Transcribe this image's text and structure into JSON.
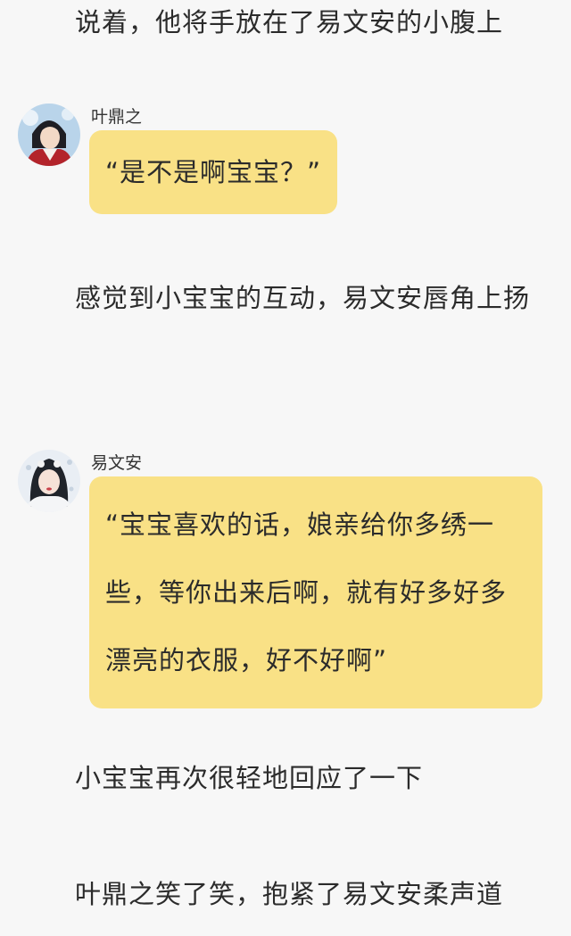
{
  "paragraphs": {
    "p1": "说着，他将手放在了易文安的小腹上",
    "p2": "感觉到小宝宝的互动，易文安唇角上扬",
    "p3": "小宝宝再次很轻地回应了一下",
    "p4": "叶鼎之笑了笑，抱紧了易文安柔声道"
  },
  "messages": {
    "m1": {
      "speaker": "叶鼎之",
      "avatar_icon": "male-character-avatar",
      "text": "“是不是啊宝宝？”"
    },
    "m2": {
      "speaker": "易文安",
      "avatar_icon": "female-character-avatar",
      "text": "“宝宝喜欢的话，娘亲给你多绣一些，等你出来后啊，就有好多好多漂亮的衣服，好不好啊”"
    }
  },
  "colors": {
    "background": "#f7f7f7",
    "bubble": "#f9e186",
    "text": "#2b2b2b"
  }
}
